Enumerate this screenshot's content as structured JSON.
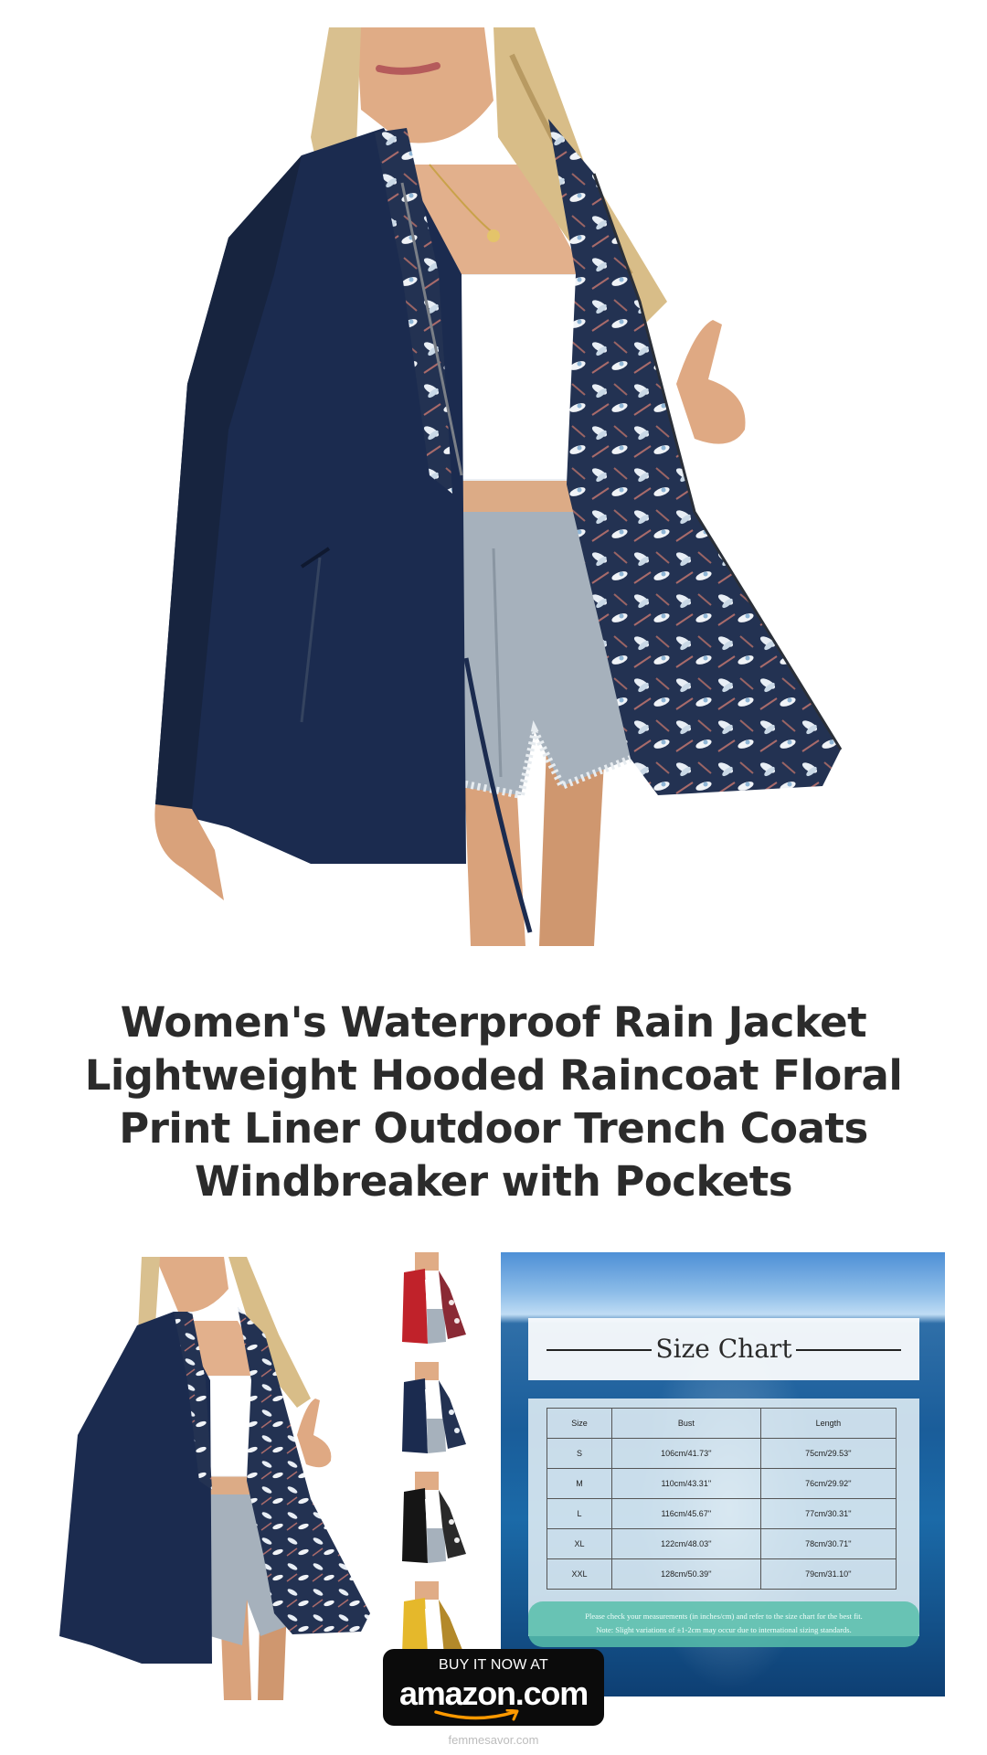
{
  "product": {
    "title": "Women's Waterproof Rain Jacket Lightweight Hooded Raincoat Floral Print Liner Outdoor Trench Coats Windbreaker with Pockets"
  },
  "colors": {
    "jacket_navy": "#1b2b4f",
    "floral_liner": "#233252",
    "denim": "#a6b1bc",
    "top_white": "#ffffff",
    "thumb_colors": [
      "#c0222a",
      "#1b2b4f",
      "#151515",
      "#e5b82b"
    ]
  },
  "size_chart": {
    "title": "Size Chart",
    "headers": [
      "Size",
      "Bust",
      "Length"
    ],
    "rows": [
      [
        "S",
        "106cm/41.73''",
        "75cm/29.53''"
      ],
      [
        "M",
        "110cm/43.31''",
        "76cm/29.92''"
      ],
      [
        "L",
        "116cm/45.67''",
        "77cm/30.31''"
      ],
      [
        "XL",
        "122cm/48.03''",
        "78cm/30.71''"
      ],
      [
        "XXL",
        "128cm/50.39''",
        "79cm/31.10''"
      ]
    ],
    "note_line1": "Please check your measurements (in inches/cm) and refer to the size chart for the best fit.",
    "note_line2": "Note: Slight variations of ±1-2cm may occur due to international sizing standards."
  },
  "cta": {
    "line1": "BUY IT NOW AT",
    "brand": "amazon.com"
  },
  "footer": {
    "site": "femmesavor.com"
  }
}
